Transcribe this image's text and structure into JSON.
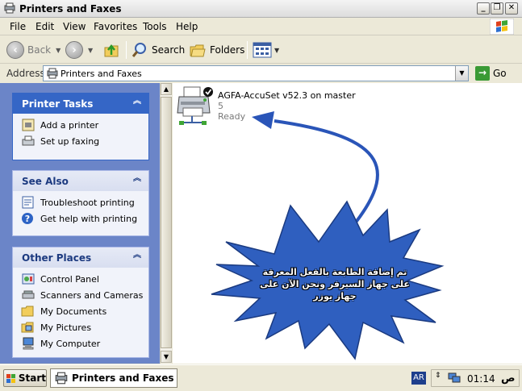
{
  "window": {
    "title": "Printers and Faxes",
    "controls": {
      "minimize": "_",
      "maximize": "❐",
      "close": "✕"
    }
  },
  "menubar": {
    "items": [
      "File",
      "Edit",
      "View",
      "Favorites",
      "Tools",
      "Help"
    ]
  },
  "toolbar": {
    "back_label": "Back",
    "search_label": "Search",
    "folders_label": "Folders"
  },
  "address": {
    "label": "Address",
    "value": "Printers and Faxes",
    "go_label": "Go"
  },
  "sidebar": {
    "printer_tasks": {
      "title": "Printer Tasks",
      "items": [
        {
          "label": "Add a printer",
          "icon": "add-printer-icon"
        },
        {
          "label": "Set up faxing",
          "icon": "fax-icon"
        }
      ]
    },
    "see_also": {
      "title": "See Also",
      "items": [
        {
          "label": "Troubleshoot printing",
          "icon": "troubleshoot-icon"
        },
        {
          "label": "Get help with printing",
          "icon": "help-icon"
        }
      ]
    },
    "other_places": {
      "title": "Other Places",
      "items": [
        {
          "label": "Control Panel",
          "icon": "control-panel-icon"
        },
        {
          "label": "Scanners and Cameras",
          "icon": "scanner-icon"
        },
        {
          "label": "My Documents",
          "icon": "folder-icon"
        },
        {
          "label": "My Pictures",
          "icon": "pictures-icon"
        },
        {
          "label": "My Computer",
          "icon": "computer-icon"
        }
      ]
    }
  },
  "content": {
    "printer": {
      "name": "AGFA-AccuSet v52.3 on master",
      "jobs": "5",
      "status": "Ready"
    },
    "annotation": {
      "line1": "تم إضافة الطابعة بالفعل المعرفة",
      "line2": "على جهاز السيرفر ونحن الآن على",
      "line3": "جهاز يوزر"
    }
  },
  "taskbar": {
    "start_label": "Start",
    "task_label": "Printers and Faxes",
    "lang": "AR",
    "clock": "01:14",
    "ampm": "ص"
  },
  "colors": {
    "sidebar_bg": "#6b85c8",
    "panel_header_blue": "#3566c6",
    "burst_fill": "#2f5fbf",
    "arrow": "#2a55b8"
  }
}
